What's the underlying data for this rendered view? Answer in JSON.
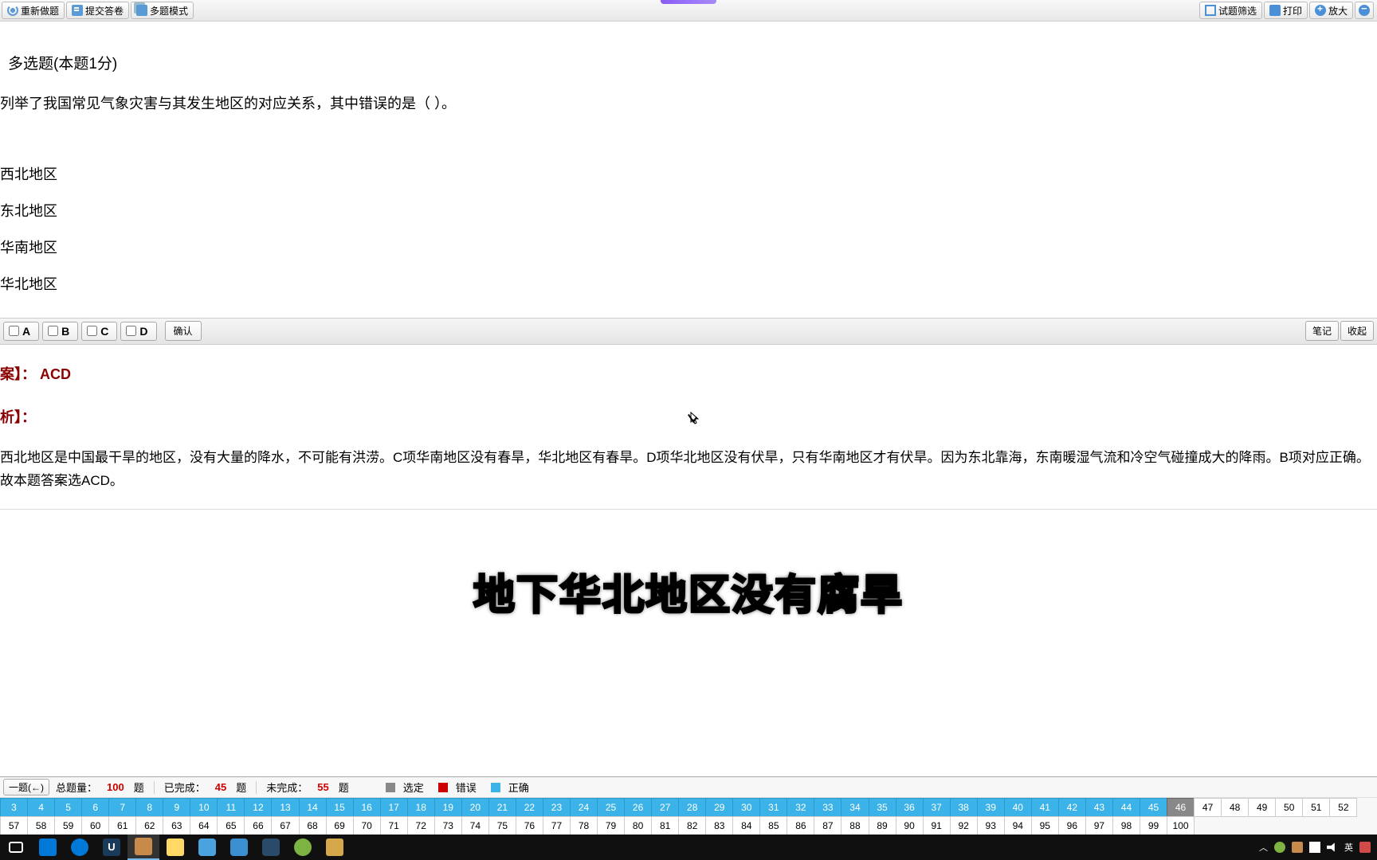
{
  "toolbar": {
    "left": {
      "redo": "重新做题",
      "submit": "提交答卷",
      "multi": "多题模式"
    },
    "right": {
      "filter": "试题筛选",
      "print": "打印",
      "zoom": "放大"
    }
  },
  "question": {
    "type": "多选题(本题1分)",
    "stem": "列举了我国常见气象灾害与其发生地区的对应关系，其中错误的是（ ）。",
    "options": {
      "a": "西北地区",
      "b": "东北地区",
      "c": "华南地区",
      "d": "华北地区"
    }
  },
  "choices": {
    "a": "A",
    "b": "B",
    "c": "C",
    "d": "D",
    "confirm": "确认"
  },
  "rightbar": {
    "note": "笔记",
    "collapse": "收起"
  },
  "answer": {
    "label": "案】：",
    "value": "ACD",
    "analysis_label": "析】：",
    "analysis_text": "西北地区是中国最干旱的地区，没有大量的降水，不可能有洪涝。C项华南地区没有春旱，华北地区有春旱。D项华北地区没有伏旱，只有华南地区才有伏旱。因为东北靠海，东南暖湿气流和冷空气碰撞成大的降雨。B项对应正确。故本题答案选ACD。"
  },
  "caption": "地下华北地区没有腐旱",
  "stats": {
    "prev": "一题(←)",
    "total_label": "总题量：",
    "total_num": "100",
    "total_unit": "题",
    "done_label": "已完成：",
    "done_num": "45",
    "done_unit": "题",
    "undone_label": "未完成：",
    "undone_num": "55",
    "undone_unit": "题",
    "legend_selected": "选定",
    "legend_wrong": "错误",
    "legend_right": "正确"
  },
  "nav": {
    "total": 100,
    "current": 46,
    "completed_through": 45,
    "row2_start": 57
  },
  "taskbar": {
    "ime": "英"
  }
}
